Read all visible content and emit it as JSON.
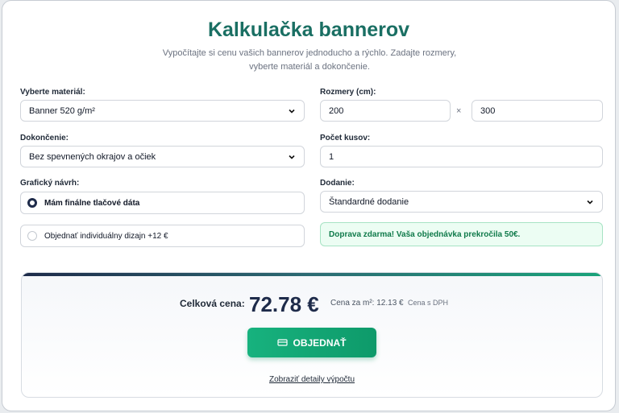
{
  "header": {
    "title": "Kalkulačka bannerov",
    "subtitle": "Vypočítajte si cenu vašich bannerov jednoducho a rýchlo. Zadajte rozmery, vyberte materiál a dokončenie."
  },
  "material": {
    "label": "Vyberte materiál:",
    "value": "Banner 520 g/m²"
  },
  "dimensions": {
    "label": "Rozmery (cm):",
    "width": "200",
    "height": "300",
    "separator": "×"
  },
  "finish": {
    "label": "Dokončenie:",
    "value": "Bez spevnených okrajov a očiek"
  },
  "quantity": {
    "label": "Počet kusov:",
    "value": "1"
  },
  "design": {
    "label": "Grafický návrh:",
    "options": [
      {
        "label": "Mám finálne tlačové dáta",
        "selected": true
      },
      {
        "label": "Objednať individuálny dizajn +12 €",
        "selected": false
      }
    ]
  },
  "delivery": {
    "label": "Dodanie:",
    "value": "Štandardné dodanie"
  },
  "notice": {
    "text": "Doprava zdarma! Vaša objednávka prekročila 50€."
  },
  "summary": {
    "total_label": "Celková cena:",
    "total_value": "72.78 €",
    "per_m2": "Cena za m²: 12.13 €",
    "vat_note": "Cena s DPH",
    "order_button": "OBJEDNAŤ",
    "details_link": "Zobraziť detaily výpočtu"
  },
  "colors": {
    "accent": "#1a6f63",
    "primary_dark": "#1e2b4a",
    "success": "#17b27e"
  },
  "icons": {
    "select": "chevron-down-icon",
    "order": "cart-icon"
  }
}
